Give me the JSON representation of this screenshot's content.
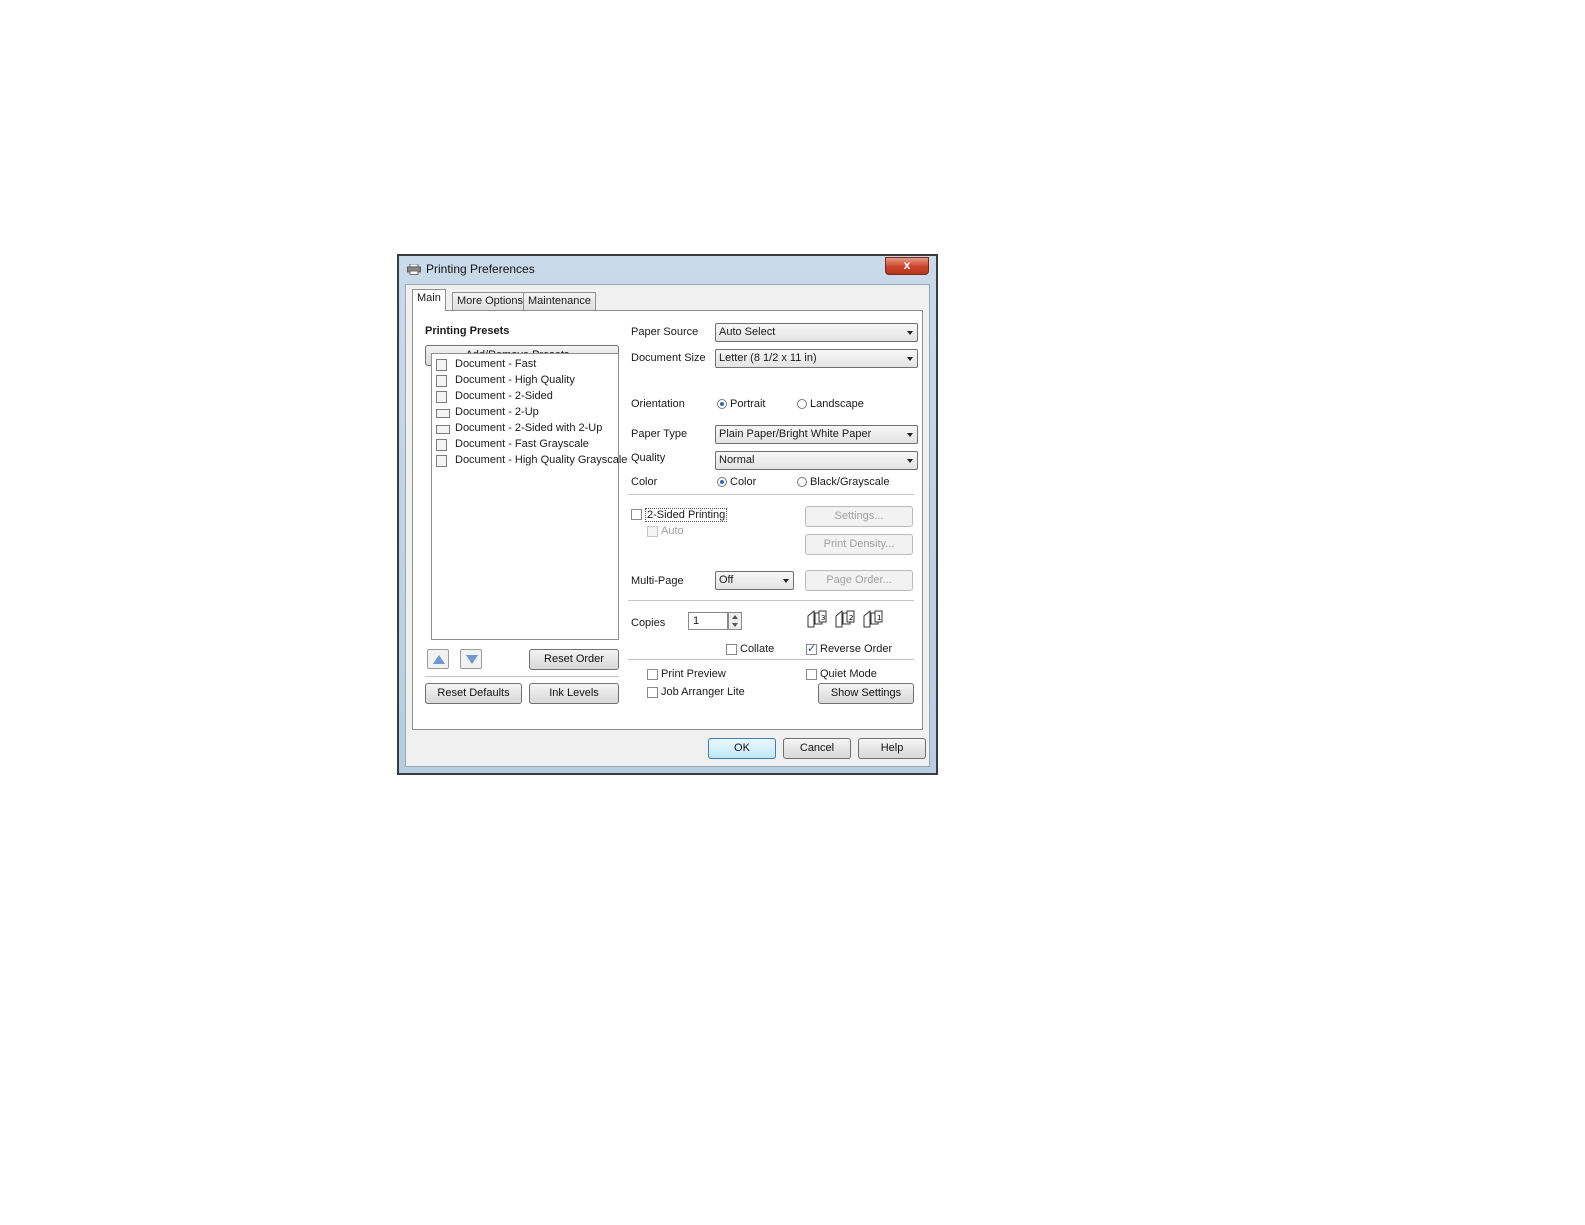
{
  "window": {
    "title": "Printing Preferences",
    "close_glyph": "x"
  },
  "tabs": [
    {
      "label": "Main",
      "active": true
    },
    {
      "label": "More Options",
      "active": false
    },
    {
      "label": "Maintenance",
      "active": false
    }
  ],
  "presets": {
    "heading": "Printing Presets",
    "add_remove_label": "Add/Remove Presets...",
    "items": [
      {
        "label": "Document - Fast",
        "icon": "document-fast-icon"
      },
      {
        "label": "Document - High Quality",
        "icon": "document-high-quality-icon"
      },
      {
        "label": "Document - 2-Sided",
        "icon": "document-2-sided-icon"
      },
      {
        "label": "Document - 2-Up",
        "icon": "document-2-up-icon"
      },
      {
        "label": "Document - 2-Sided with 2-Up",
        "icon": "document-2-sided-2-up-icon"
      },
      {
        "label": "Document - Fast Grayscale",
        "icon": "document-fast-grayscale-icon"
      },
      {
        "label": "Document - High Quality Grayscale",
        "icon": "document-high-quality-grayscale-icon"
      }
    ],
    "reset_order_label": "Reset Order",
    "reset_defaults_label": "Reset Defaults",
    "ink_levels_label": "Ink Levels"
  },
  "settings": {
    "paper_source_label": "Paper Source",
    "paper_source_value": "Auto Select",
    "document_size_label": "Document Size",
    "document_size_value": "Letter (8 1/2 x 11 in)",
    "orientation_label": "Orientation",
    "orientation_portrait": "Portrait",
    "orientation_landscape": "Landscape",
    "paper_type_label": "Paper Type",
    "paper_type_value": "Plain Paper/Bright White Paper",
    "quality_label": "Quality",
    "quality_value": "Normal",
    "color_label": "Color",
    "color_color": "Color",
    "color_bw": "Black/Grayscale",
    "two_sided_label": "2-Sided Printing",
    "auto_label": "Auto",
    "settings_button": "Settings...",
    "print_density_button": "Print Density...",
    "multi_page_label": "Multi-Page",
    "multi_page_value": "Off",
    "page_order_button": "Page Order...",
    "copies_label": "Copies",
    "copies_value": "1",
    "collate_label": "Collate",
    "reverse_order_label": "Reverse Order",
    "print_preview_label": "Print Preview",
    "quiet_mode_label": "Quiet Mode",
    "job_arranger_label": "Job Arranger Lite",
    "show_settings_button": "Show Settings"
  },
  "footer": {
    "ok": "OK",
    "cancel": "Cancel",
    "help": "Help"
  }
}
